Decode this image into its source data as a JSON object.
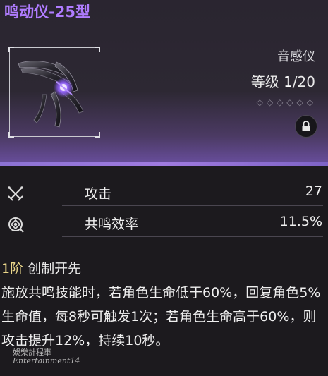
{
  "weapon": {
    "name": "鸣动仪-25型",
    "type": "音感仪",
    "level_label": "等级",
    "level_current": "1",
    "level_sep": "/",
    "level_max": "20",
    "tune_dots": "◇◇◇◇◇◇",
    "lock_icon": "lock-icon",
    "accent_color": "#b07cff",
    "rarity_color": "#8c72d4"
  },
  "stats": [
    {
      "icon": "crossed-swords-icon",
      "label": "攻击",
      "value": "27"
    },
    {
      "icon": "resonance-target-icon",
      "label": "共鸣效率",
      "value": "11.5%"
    }
  ],
  "skill": {
    "rank": "1阶",
    "name": "创制开先",
    "description": "施放共鸣技能时，若角色生命低于60%，回复角色5%生命值，每8秒可触发1次；若角色生命高于60%，则攻击提升12%，持续10秒。"
  },
  "watermark": {
    "line1": "娛樂計程車",
    "line2": "Entertainment14"
  }
}
